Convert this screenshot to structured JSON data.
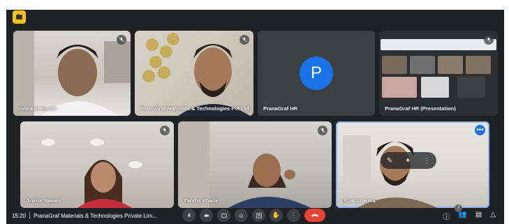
{
  "meeting": {
    "time": "15:20",
    "title": "PranaGraf Materials & Technologies Private Lim...",
    "participant_count": "7"
  },
  "presenter_avatar_letter": "P",
  "participants": [
    {
      "name": "Avinash Kundu",
      "muted": true
    },
    {
      "name": "PranaGraf Materials & Technologies Pvt Ltd.",
      "muted": true
    },
    {
      "name": "PranaGraf HR",
      "muted": false
    },
    {
      "name": "PranaGraf HR (Presentation)",
      "muted": true
    },
    {
      "name": "Ankita Sawant",
      "muted": true
    },
    {
      "name": "Varsha Khade",
      "muted": true
    },
    {
      "name": "Urpal Sharma",
      "muted": false,
      "speaking": true
    }
  ],
  "colors": {
    "background": "#202124",
    "accent": "#1a73e8",
    "hangup": "#ea4335",
    "badge": "#f2c418"
  },
  "controls": [
    "mic-icon",
    "camera-icon",
    "captions-icon",
    "emoji-icon",
    "present-icon",
    "raise-hand-icon",
    "more-options-icon",
    "hangup-icon"
  ],
  "right_controls": [
    "info-icon",
    "people-icon",
    "chat-icon",
    "activities-icon"
  ]
}
